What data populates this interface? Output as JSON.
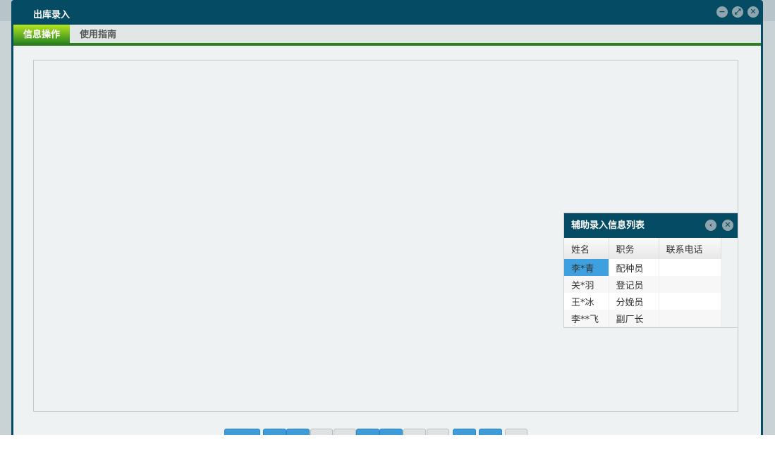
{
  "window": {
    "title": "出库录入"
  },
  "tabs": [
    {
      "label": "信息操作",
      "active": true
    },
    {
      "label": "使用指南",
      "active": false
    }
  ],
  "panel": {
    "title": "辅助录入信息列表",
    "columns": [
      "姓名",
      "职务",
      "联系电话"
    ],
    "rows": [
      [
        "李*青",
        "配种员",
        ""
      ],
      [
        "关*羽",
        "登记员",
        ""
      ],
      [
        "王*冰",
        "分娩员",
        ""
      ],
      [
        "李**飞",
        "副厂长",
        ""
      ]
    ]
  },
  "buttons": [
    "blue",
    "blue",
    "blue",
    "gray",
    "gray",
    "blue",
    "blue",
    "gray",
    "gray",
    "blue",
    "blue",
    "gray"
  ],
  "colors": {
    "titlebar": "#044b63",
    "accent": "#2e7d1e",
    "selected": "#3fa0df"
  }
}
